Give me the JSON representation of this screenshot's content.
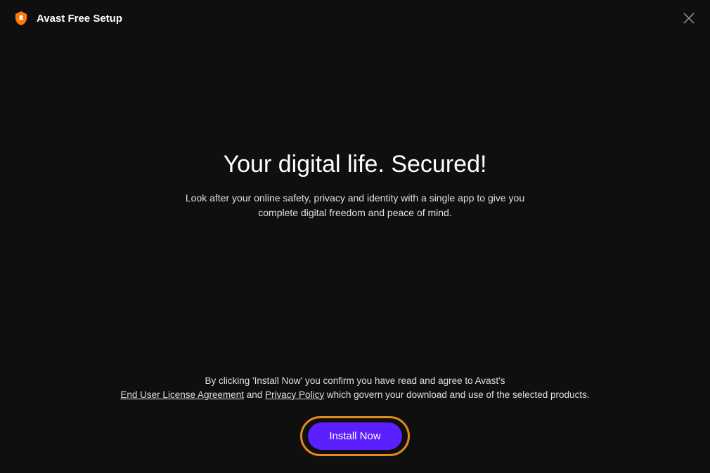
{
  "header": {
    "title": "Avast Free Setup"
  },
  "main": {
    "headline": "Your digital life. Secured!",
    "subtext": "Look after your online safety, privacy and identity with a single app to give you complete digital freedom and peace of mind."
  },
  "footer": {
    "legal_pre": "By clicking 'Install Now' you confirm you have read and agree to Avast's",
    "eula_link": "End User License Agreement",
    "legal_and": "  and  ",
    "privacy_link": "Privacy Policy",
    "legal_post": "  which govern your download and use of the selected products.",
    "install_button": "Install Now"
  }
}
